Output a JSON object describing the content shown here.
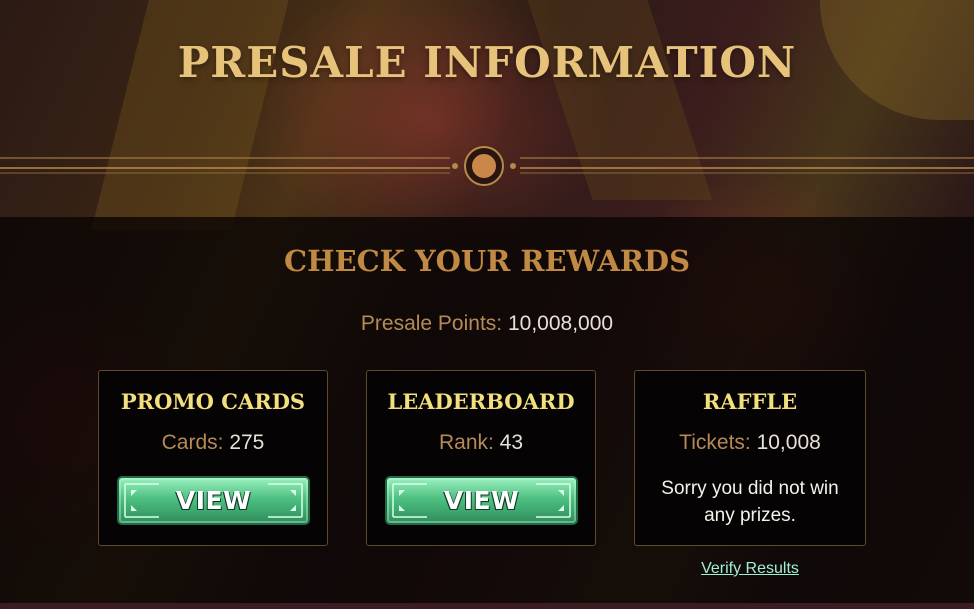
{
  "header": {
    "title": "PRESALE INFORMATION"
  },
  "rewards": {
    "heading": "CHECK YOUR REWARDS",
    "points_label": "Presale Points:",
    "points_value": "10,008,000"
  },
  "cards": {
    "promo": {
      "title": "PROMO CARDS",
      "stat_label": "Cards:",
      "stat_value": "275",
      "button_label": "VIEW"
    },
    "leaderboard": {
      "title": "LEADERBOARD",
      "stat_label": "Rank:",
      "stat_value": "43",
      "button_label": "VIEW"
    },
    "raffle": {
      "title": "RAFFLE",
      "stat_label": "Tickets:",
      "stat_value": "10,008",
      "message_line1": "Sorry you did not win",
      "message_line2": "any prizes.",
      "verify_link": "Verify Results"
    }
  },
  "colors": {
    "title_gold": "#e6c27a",
    "subtitle_bronze": "#c08a45",
    "card_title_yellow": "#f2df7e",
    "button_green": "#4fc082",
    "link_mint": "#9ff0d6"
  }
}
